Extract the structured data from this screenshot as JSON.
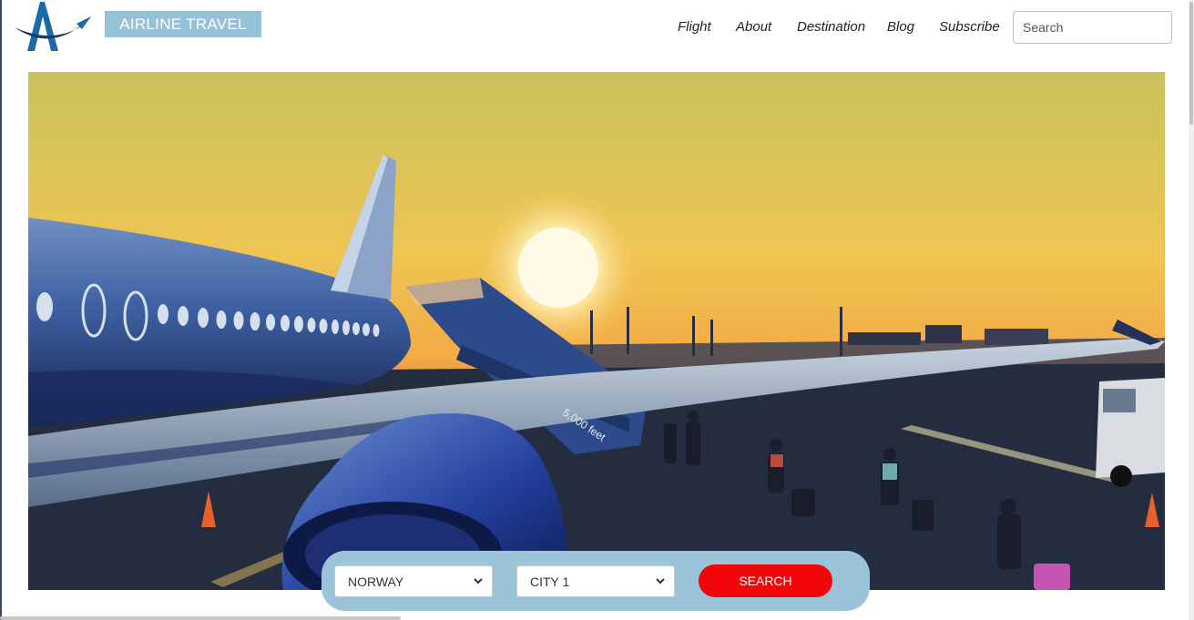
{
  "header": {
    "brand": "AIRLINE TRAVEL",
    "logo_icon": "airline-logo-icon",
    "nav": [
      {
        "id": "flight",
        "label": "Flight"
      },
      {
        "id": "about",
        "label": "About"
      },
      {
        "id": "destination",
        "label": "Destination"
      },
      {
        "id": "blog",
        "label": "Blog"
      },
      {
        "id": "subscribe",
        "label": "Subscribe"
      }
    ],
    "search": {
      "placeholder": "Search",
      "value": ""
    }
  },
  "hero": {
    "image_icon": "airport-sunset-photo",
    "visible_text": "5,000 feet"
  },
  "booking": {
    "country": {
      "selected": "NORWAY"
    },
    "city": {
      "selected": "CITY 1"
    },
    "search_label": "SEARCH"
  },
  "colors": {
    "brand_bg": "#96c2d9",
    "panel_bg": "#9cc4d9",
    "search_button": "#f2060c",
    "logo_blue": "#1b6aa6",
    "logo_navy": "#143a6b"
  }
}
